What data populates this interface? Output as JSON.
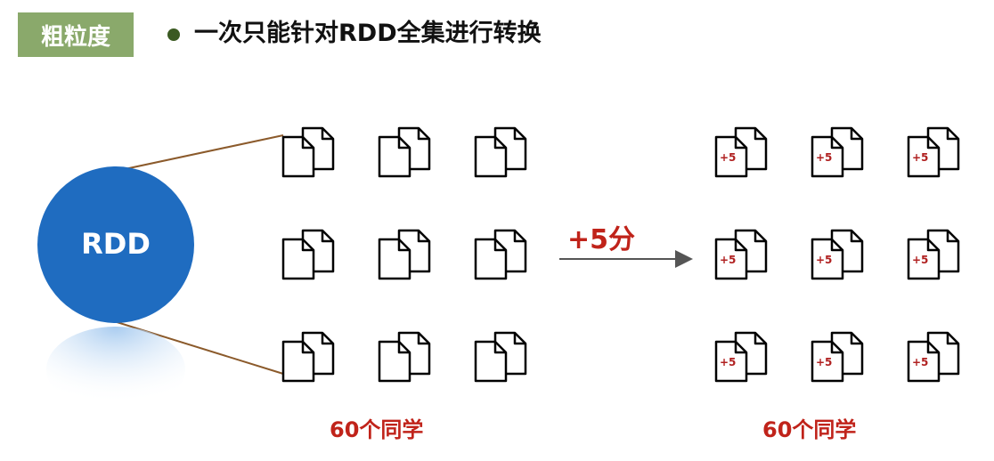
{
  "header": {
    "tag_label": "粗粒度",
    "headline": "一次只能针对RDD全集进行转换"
  },
  "diagram": {
    "rdd_label": "RDD",
    "operation_label": "+5分",
    "doc_mark": "+5",
    "left_caption": "60个同学",
    "right_caption": "60个同学",
    "left_grid": {
      "rows": 3,
      "cols": 3,
      "icon": "document-pair-icon"
    },
    "right_grid": {
      "rows": 3,
      "cols": 3,
      "icon": "marked-document-pair-icon"
    }
  },
  "colors": {
    "tag_bg": "#8aa96b",
    "rdd_circle": "#1f6cc0",
    "accent_red": "#c0231a",
    "connector": "#8b5a2b"
  }
}
